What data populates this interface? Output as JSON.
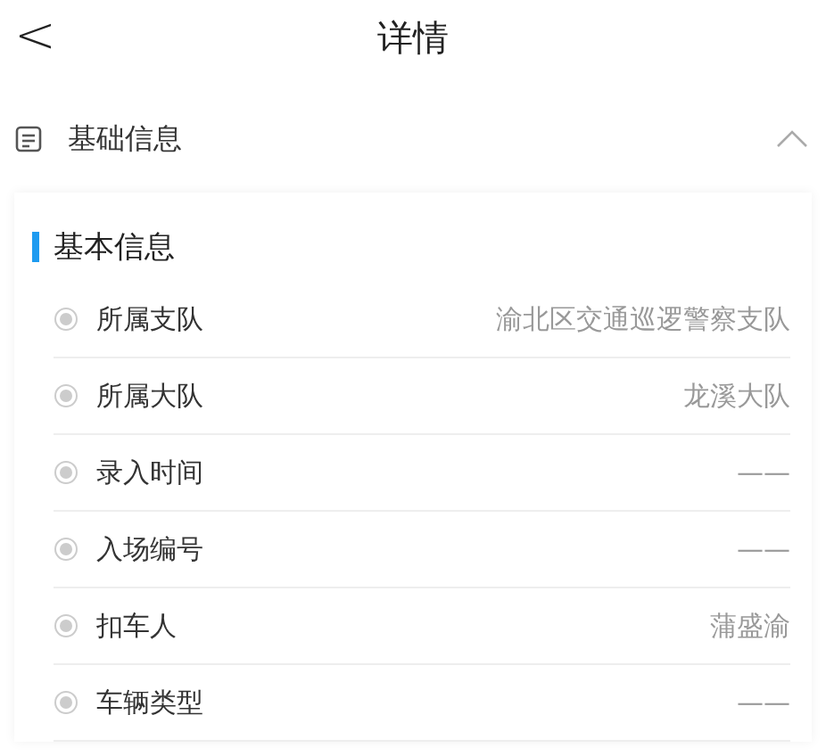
{
  "header": {
    "back": "<",
    "title": "详情"
  },
  "section": {
    "title": "基础信息",
    "expanded": true,
    "subtitle": "基本信息",
    "rows": [
      {
        "label": "所属支队",
        "value": "渝北区交通巡逻警察支队"
      },
      {
        "label": "所属大队",
        "value": "龙溪大队"
      },
      {
        "label": "录入时间",
        "value": "——"
      },
      {
        "label": "入场编号",
        "value": "——"
      },
      {
        "label": "扣车人",
        "value": "蒲盛渝"
      },
      {
        "label": "车辆类型",
        "value": "——"
      }
    ]
  }
}
